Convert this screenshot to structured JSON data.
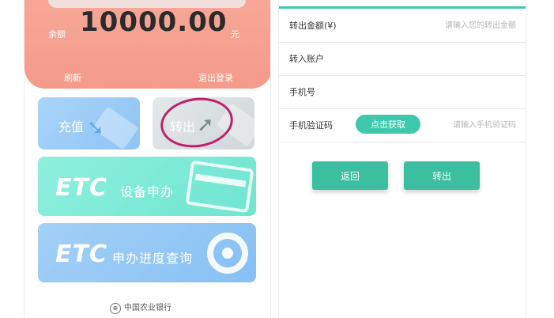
{
  "account": {
    "balance_label": "余额",
    "balance_value": "10000.00",
    "balance_unit": "元",
    "refresh_label": "刷新",
    "logout_label": "退出登录"
  },
  "tiles": {
    "recharge_label": "充值",
    "transfer_label": "转出",
    "etc_apply_logo": "ETC",
    "etc_apply_label": "设备申办",
    "etc_query_logo": "ETC",
    "etc_query_label": "申办进度查询"
  },
  "footer": {
    "bank_name": "中国农业银行"
  },
  "form": {
    "amount_label": "转出金额(¥)",
    "amount_placeholder": "请输入您的转出金额",
    "account_label": "转入账户",
    "phone_label": "手机号",
    "code_label": "手机验证码",
    "get_code_label": "点击获取",
    "code_placeholder": "请输入手机验证码",
    "back_label": "返回",
    "submit_label": "转出"
  },
  "colors": {
    "accent": "#3fc8ac",
    "balance_card": "#f59a8b",
    "annotation": "#c0206a"
  }
}
